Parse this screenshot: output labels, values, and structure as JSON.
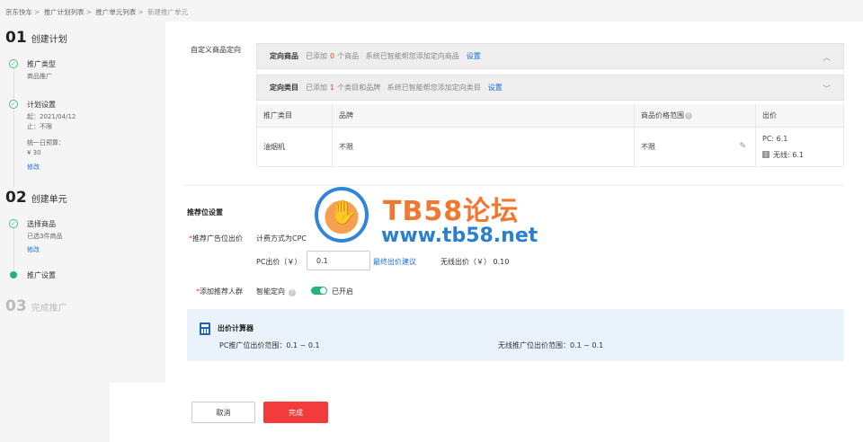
{
  "breadcrumb": [
    "京东快车",
    "推广计划列表",
    "推广单元列表",
    "新建推广单元"
  ],
  "sidebar": {
    "step1": {
      "num": "01",
      "label": "创建计划"
    },
    "step1_items": {
      "type_title": "推广类型",
      "type_value": "商品推广",
      "plan_title": "计划设置",
      "plan_start": "起：2021/04/12",
      "plan_end": "止：不限",
      "budget_label": "统一日预算：",
      "budget_value": "¥  30",
      "edit": "修改"
    },
    "step2": {
      "num": "02",
      "label": "创建单元"
    },
    "step2_items": {
      "goods_title": "选择商品",
      "goods_value": "已选3件商品",
      "edit": "修改",
      "rec_title": "推广设置"
    },
    "step3": {
      "num": "03",
      "label": "完成推广"
    }
  },
  "custom": {
    "label": "自定义商品定向",
    "panel1": {
      "title": "定向商品",
      "pre": "已添加",
      "count": "0",
      "post": "个商品",
      "hint": "系统已智能帮您添加定向商品",
      "link": "设置"
    },
    "panel2": {
      "title": "定向类目",
      "pre": "已添加",
      "count": "1",
      "post": "个类目和品牌",
      "hint": "系统已智能帮您添加定向类目",
      "link": "设置"
    },
    "table": {
      "headers": [
        "推广类目",
        "品牌",
        "商品价格范围",
        "出价"
      ],
      "row": {
        "category": "油烟机",
        "brand": "不限",
        "price": "不限",
        "pc_bid": "PC: 6.1",
        "mobile_bid": "无线: 6.1"
      }
    }
  },
  "rec": {
    "section_title": "推荐位设置",
    "bid_label": "推荐广告位出价",
    "cost_mode": "计费方式为CPC",
    "pc_bid_label": "PC出价（￥）",
    "pc_bid_value": "0.1",
    "suggest_link": "最终出价建议",
    "mobile_bid": "无线出价（￥） 0.10",
    "crowd_label": "添加推荐人群",
    "smart_label": "智能定向",
    "toggle_state": "已开启",
    "toggle_on": true
  },
  "calculator": {
    "title": "出价计算器",
    "pc_range": "PC推广位出价范围：0.1 ~ 0.1",
    "mobile_range": "无线推广位出价范围：0.1 ~ 0.1"
  },
  "footer": {
    "cancel": "取消",
    "done": "完成"
  },
  "watermark": {
    "title": "TB58论坛",
    "url": "www.tb58.net"
  },
  "colors": {
    "accent_red": "#f33b3b",
    "link_blue": "#1a6fe0",
    "success_green": "#21b576"
  }
}
